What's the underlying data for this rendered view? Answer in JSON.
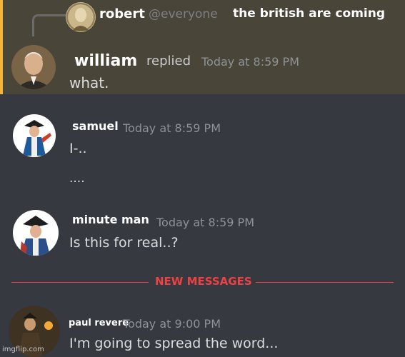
{
  "reply_ref": {
    "author": "robert",
    "mention": "@everyone",
    "text": "the british are coming"
  },
  "messages": [
    {
      "author": "william",
      "action": "replied",
      "timestamp": "Today at 8:59 PM",
      "lines": [
        "what."
      ]
    },
    {
      "author": "samuel",
      "timestamp": "Today at 8:59 PM",
      "lines": [
        "I-..",
        "...."
      ]
    },
    {
      "author": "minute man",
      "timestamp": "Today at 8:59 PM",
      "lines": [
        "Is this for real..?"
      ]
    },
    {
      "author": "paul revere",
      "timestamp": "Today at 9:00 PM",
      "lines": [
        "I'm going to spread the word..."
      ]
    }
  ],
  "divider": {
    "label": "NEW MESSAGES"
  },
  "watermark": "imgflip.com",
  "colors": {
    "background": "#36393f",
    "highlight": "#4a4539",
    "highlight_bar": "#f1b43d",
    "new_messages": "#ed4245",
    "timestamp": "#8e9297"
  }
}
